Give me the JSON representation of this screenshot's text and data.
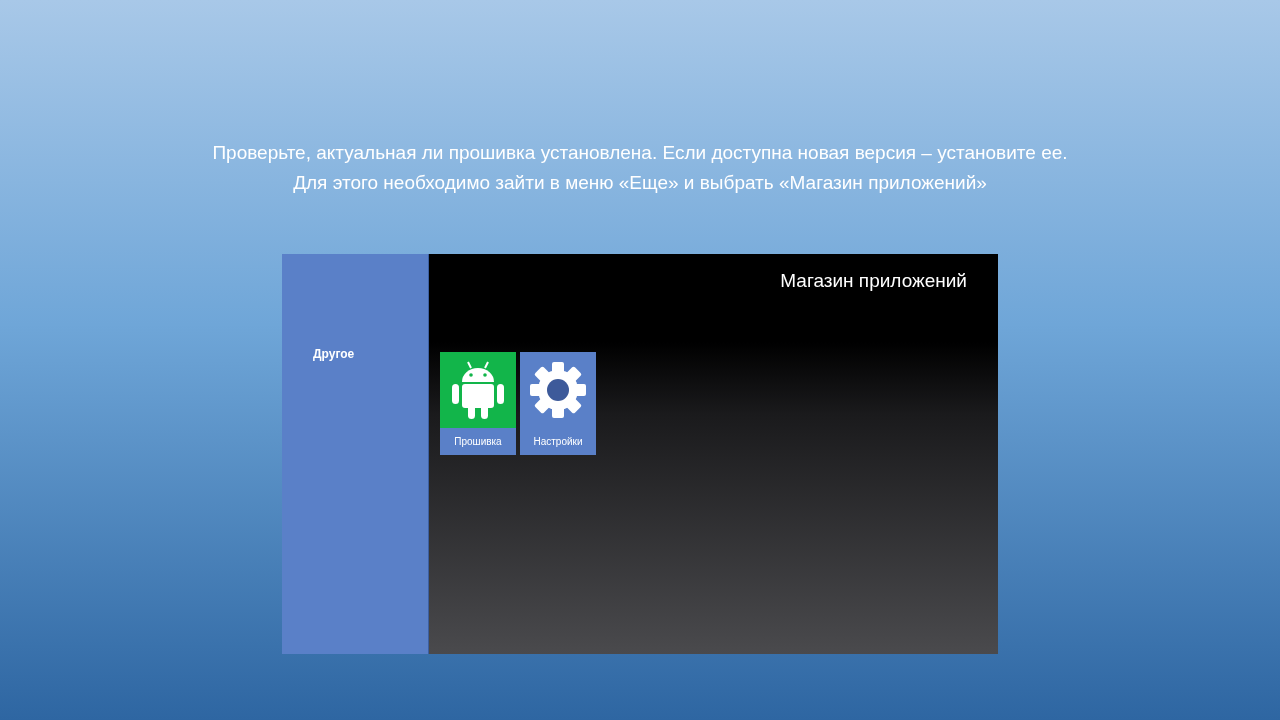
{
  "instructions": [
    "Проверьте, актуальная ли прошивка установлена. Если доступна новая версия – установите ее.",
    "Для этого необходимо зайти в меню «Еще» и выбрать «Магазин приложений»"
  ],
  "screen": {
    "sidebar": {
      "items": [
        "Другое"
      ]
    },
    "title": "Магазин приложений",
    "apps": [
      {
        "label": "Прошивка",
        "kind": "android",
        "color": "#12b54a"
      },
      {
        "label": "Настройки",
        "kind": "gear",
        "color": "#5a80c8"
      }
    ]
  }
}
